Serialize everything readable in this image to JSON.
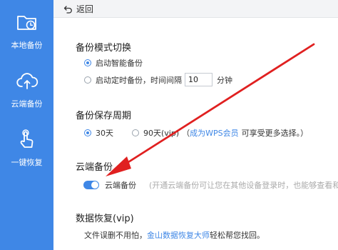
{
  "sidebar": {
    "items": [
      {
        "label": "本地备份",
        "icon": "folder-clock-icon"
      },
      {
        "label": "云端备份",
        "icon": "cloud-upload-icon"
      },
      {
        "label": "一键恢复",
        "icon": "hand-tap-icon"
      }
    ]
  },
  "topbar": {
    "back_label": "返回"
  },
  "mode": {
    "title": "备份模式切换",
    "option_smart": "启动智能备份",
    "option_timed_prefix": "启动定时备份，时间间隔",
    "interval_value": "10",
    "interval_unit": "分钟"
  },
  "retention": {
    "title": "备份保存周期",
    "option_30": "30天",
    "option_90": "90天(vip)",
    "note_open": "（",
    "note_link": "成为WPS会员",
    "note_rest": "可享受更多选择。）"
  },
  "cloud": {
    "title": "云端备份",
    "toggle_label": "云端备份",
    "hint": "(开通云端备份可让您在其他设备登录时，也能够查看和编"
  },
  "restore": {
    "title": "数据恢复(vip)",
    "text_before": "文件误删不用怕，",
    "link": "金山数据恢复大师",
    "text_after": "轻松帮您找回。"
  },
  "colors": {
    "accent": "#3f87e6",
    "arrow": "#e02020"
  }
}
